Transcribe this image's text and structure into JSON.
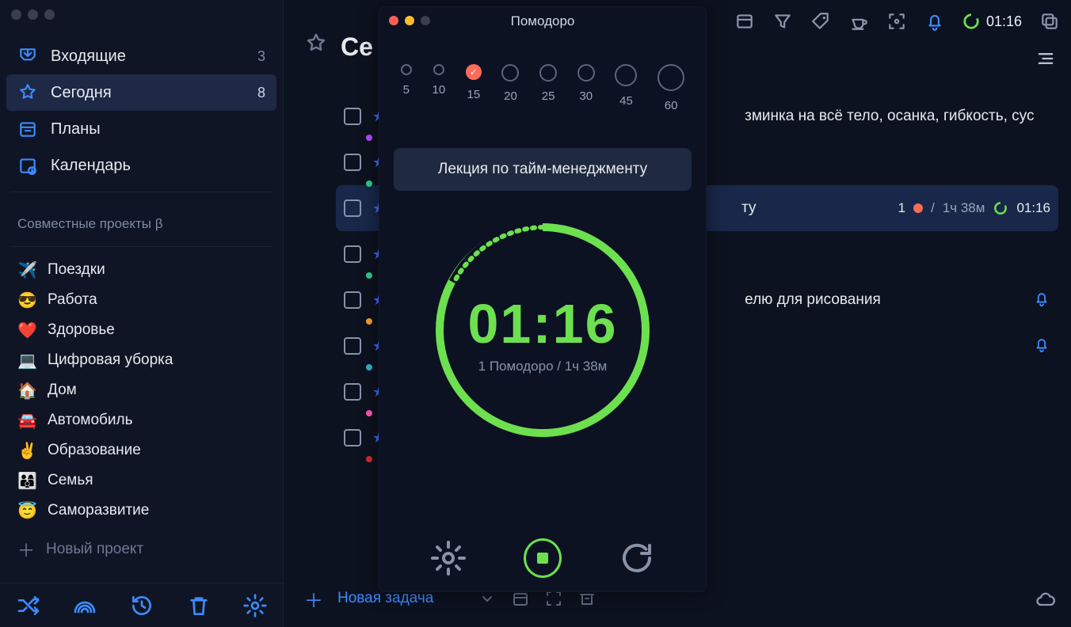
{
  "sidebar": {
    "inbox": {
      "label": "Входящие",
      "count": "3"
    },
    "today": {
      "label": "Сегодня",
      "count": "8"
    },
    "plans": {
      "label": "Планы"
    },
    "calendar": {
      "label": "Календарь"
    },
    "shared_section": "Совместные проекты β",
    "projects": [
      {
        "emoji": "✈️",
        "label": "Поездки"
      },
      {
        "emoji": "😎",
        "label": "Работа"
      },
      {
        "emoji": "❤️",
        "label": "Здоровье"
      },
      {
        "emoji": "💻",
        "label": "Цифровая уборка"
      },
      {
        "emoji": "🏠",
        "label": "Дом"
      },
      {
        "emoji": "🚘",
        "label": "Автомобиль"
      },
      {
        "emoji": "✌️",
        "label": "Образование"
      },
      {
        "emoji": "👨‍👩‍👦",
        "label": "Семья"
      },
      {
        "emoji": "😇",
        "label": "Саморазвитие"
      }
    ],
    "new_project": "Новый проект"
  },
  "main": {
    "title_visible": "Се",
    "toolbar_time": "01:16",
    "task_tail": "зминка на всё тело, осанка, гибкость, сус",
    "task_drawing": "елю для рисования",
    "selected": {
      "tail": "ту",
      "count": "1",
      "duration": "1ч 38м",
      "time": "01:16"
    },
    "new_task": "Новая задача"
  },
  "pomodoro": {
    "title": "Помодоро",
    "intervals": [
      "5",
      "10",
      "15",
      "20",
      "25",
      "30",
      "45",
      "60"
    ],
    "task_name": "Лекция по тайм-менеджменту",
    "time": "01:16",
    "subline": "1 Помодоро / 1ч 38м"
  }
}
